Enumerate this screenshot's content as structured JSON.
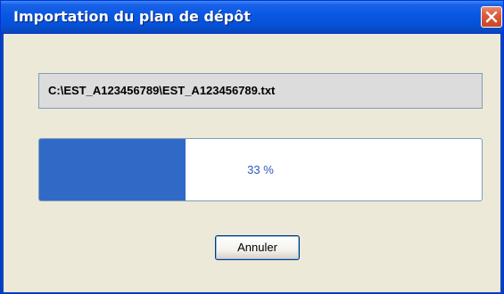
{
  "window": {
    "title": "Importation du plan de dépôt"
  },
  "file": {
    "path": "C:\\EST_A123456789\\EST_A123456789.txt"
  },
  "progress": {
    "percent": 33,
    "label": "33 %"
  },
  "actions": {
    "cancel_label": "Annuler"
  },
  "icons": {
    "close": "close-icon"
  },
  "colors": {
    "titlebar": "#0857e3",
    "progress_fill": "#3169c6",
    "close_button": "#dd5a3a",
    "dialog_background": "#ece9d8"
  }
}
